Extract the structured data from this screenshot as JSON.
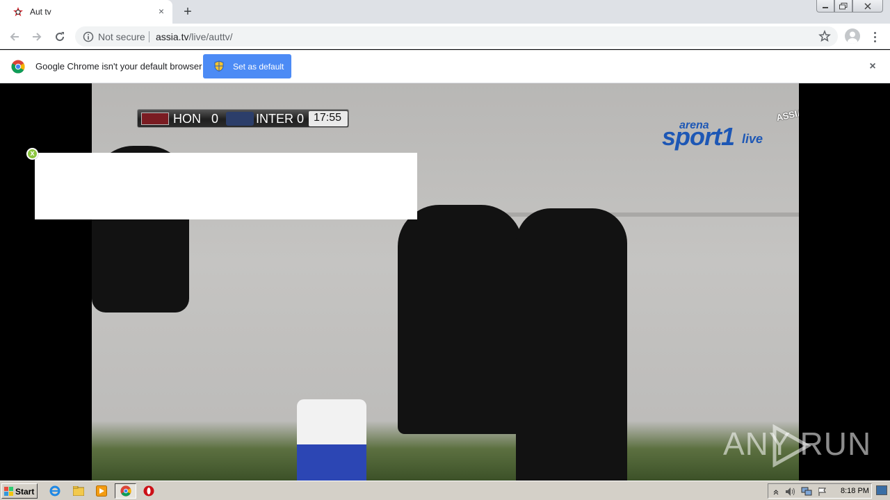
{
  "browser": {
    "tab": {
      "title": "Aut tv",
      "close_label": "×"
    },
    "new_tab_label": "+",
    "address": {
      "security_label": "Not secure",
      "host": "assia.tv",
      "path": "/live/auttv/"
    }
  },
  "infobar": {
    "message": "Google Chrome isn't your default browser",
    "button_label": "Set as default",
    "close_label": "×"
  },
  "video": {
    "scorebug": {
      "home": "HON",
      "home_score": "0",
      "away": "INTER",
      "away_score": "0",
      "clock": "17:55"
    },
    "channel_logo": {
      "line1": "arena",
      "line2": "sport1",
      "line3": "live"
    },
    "site_logo": "ASSIA.TV",
    "watermark": "ANY RUN",
    "ad_close_label": "x"
  },
  "taskbar": {
    "start_label": "Start",
    "clock": "8:18 PM"
  },
  "colors": {
    "infobar_button": "#4c8bf5",
    "ad_close": "#8cc63f",
    "arena_blue": "#1d57b5"
  }
}
